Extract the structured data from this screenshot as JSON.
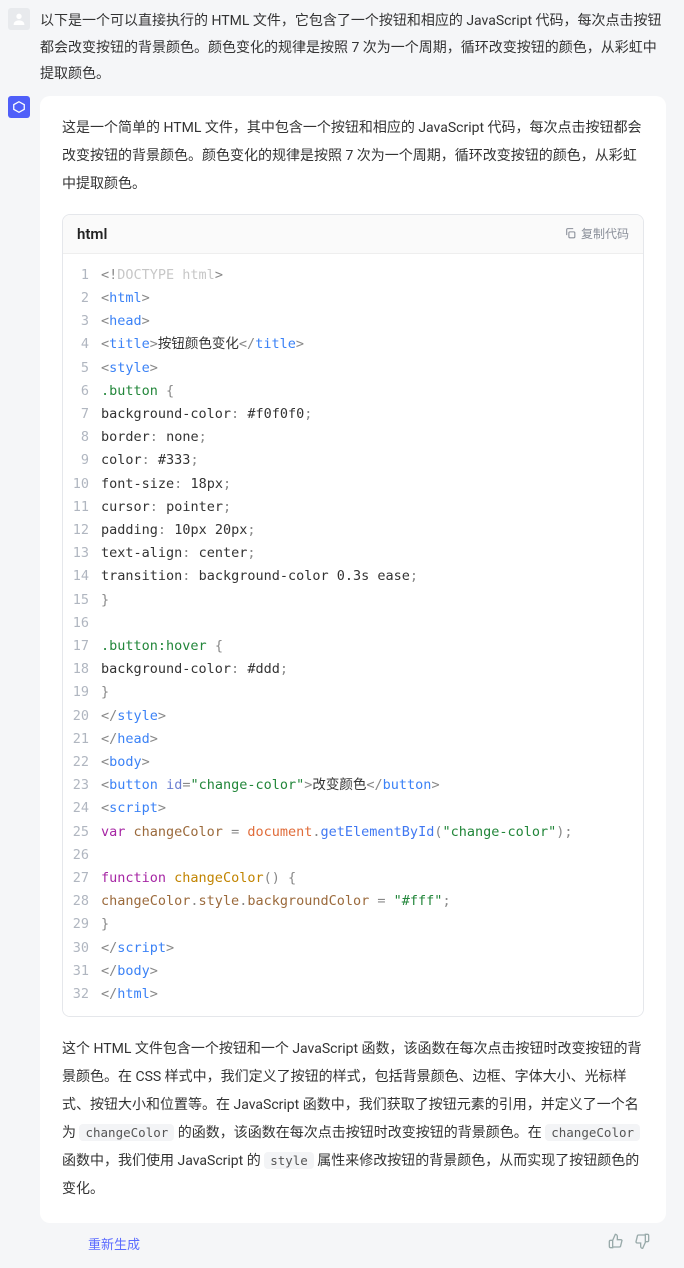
{
  "user_message": "以下是一个可以直接执行的 HTML 文件，它包含了一个按钮和相应的 JavaScript 代码，每次点击按钮都会改变按钮的背景颜色。颜色变化的规律是按照 7 次为一个周期，循环改变按钮的颜色，从彩虹中提取颜色。",
  "bot_intro": "这是一个简单的 HTML 文件，其中包含一个按钮和相应的 JavaScript 代码，每次点击按钮都会改变按钮的背景颜色。颜色变化的规律是按照 7 次为一个周期，循环改变按钮的颜色，从彩虹中提取颜色。",
  "code": {
    "language": "html",
    "copy_label": "复制代码",
    "lines": [
      {
        "n": "1",
        "html": "<span class='tok-punc'>&lt;!</span><span class='tok-doctype'>DOCTYPE html</span><span class='tok-punc'>&gt;</span>"
      },
      {
        "n": "2",
        "html": "<span class='tok-punc'>&lt;</span><span class='tok-tag'>html</span><span class='tok-punc'>&gt;</span>"
      },
      {
        "n": "3",
        "html": "<span class='tok-punc'>&lt;</span><span class='tok-tag'>head</span><span class='tok-punc'>&gt;</span>"
      },
      {
        "n": "4",
        "html": "<span class='tok-punc'>&lt;</span><span class='tok-tag'>title</span><span class='tok-punc'>&gt;</span><span class='tok-text'>按钮颜色变化</span><span class='tok-punc'>&lt;/</span><span class='tok-tag'>title</span><span class='tok-punc'>&gt;</span>"
      },
      {
        "n": "5",
        "html": "<span class='tok-punc'>&lt;</span><span class='tok-tag'>style</span><span class='tok-punc'>&gt;</span>"
      },
      {
        "n": "6",
        "html": "<span class='tok-selector'>.button</span> <span class='tok-punc'>{</span>"
      },
      {
        "n": "7",
        "html": "<span class='tok-prop'>background-color</span><span class='tok-punc'>:</span> <span class='tok-value'>#f0f0f0</span><span class='tok-punc'>;</span>"
      },
      {
        "n": "8",
        "html": "<span class='tok-prop'>border</span><span class='tok-punc'>:</span> <span class='tok-value'>none</span><span class='tok-punc'>;</span>"
      },
      {
        "n": "9",
        "html": "<span class='tok-prop'>color</span><span class='tok-punc'>:</span> <span class='tok-value'>#333</span><span class='tok-punc'>;</span>"
      },
      {
        "n": "10",
        "html": "<span class='tok-prop'>font-size</span><span class='tok-punc'>:</span> <span class='tok-value'>18px</span><span class='tok-punc'>;</span>"
      },
      {
        "n": "11",
        "html": "<span class='tok-prop'>cursor</span><span class='tok-punc'>:</span> <span class='tok-value'>pointer</span><span class='tok-punc'>;</span>"
      },
      {
        "n": "12",
        "html": "<span class='tok-prop'>padding</span><span class='tok-punc'>:</span> <span class='tok-value'>10px 20px</span><span class='tok-punc'>;</span>"
      },
      {
        "n": "13",
        "html": "<span class='tok-prop'>text-align</span><span class='tok-punc'>:</span> <span class='tok-value'>center</span><span class='tok-punc'>;</span>"
      },
      {
        "n": "14",
        "html": "<span class='tok-prop'>transition</span><span class='tok-punc'>:</span> <span class='tok-value'>background-color 0.3s ease</span><span class='tok-punc'>;</span>"
      },
      {
        "n": "15",
        "html": "<span class='tok-punc'>}</span>"
      },
      {
        "n": "16",
        "html": ""
      },
      {
        "n": "17",
        "html": "<span class='tok-selector'>.button:hover</span> <span class='tok-punc'>{</span>"
      },
      {
        "n": "18",
        "html": "<span class='tok-prop'>background-color</span><span class='tok-punc'>:</span> <span class='tok-value'>#ddd</span><span class='tok-punc'>;</span>"
      },
      {
        "n": "19",
        "html": "<span class='tok-punc'>}</span>"
      },
      {
        "n": "20",
        "html": "<span class='tok-punc'>&lt;/</span><span class='tok-tag'>style</span><span class='tok-punc'>&gt;</span>"
      },
      {
        "n": "21",
        "html": "<span class='tok-punc'>&lt;/</span><span class='tok-tag'>head</span><span class='tok-punc'>&gt;</span>"
      },
      {
        "n": "22",
        "html": "<span class='tok-punc'>&lt;</span><span class='tok-tag'>body</span><span class='tok-punc'>&gt;</span>"
      },
      {
        "n": "23",
        "html": "<span class='tok-punc'>&lt;</span><span class='tok-tag'>button</span> <span class='tok-attr'>id</span><span class='tok-punc'>=</span><span class='tok-string'>\"change-color\"</span><span class='tok-punc'>&gt;</span><span class='tok-text'>改变颜色</span><span class='tok-punc'>&lt;/</span><span class='tok-tag'>button</span><span class='tok-punc'>&gt;</span>"
      },
      {
        "n": "24",
        "html": "<span class='tok-punc'>&lt;</span><span class='tok-tag'>script</span><span class='tok-punc'>&gt;</span>"
      },
      {
        "n": "25",
        "html": "<span class='tok-kw'>var</span> <span class='tok-id'>changeColor</span> <span class='tok-punc'>=</span> <span class='tok-var'>document</span><span class='tok-punc'>.</span><span class='tok-func'>getElementById</span><span class='tok-punc'>(</span><span class='tok-string'>\"change-color\"</span><span class='tok-punc'>);</span>"
      },
      {
        "n": "26",
        "html": ""
      },
      {
        "n": "27",
        "html": "<span class='tok-kw'>function</span> <span class='tok-funcname'>changeColor</span><span class='tok-punc'>()</span> <span class='tok-punc'>{</span>"
      },
      {
        "n": "28",
        "html": "<span class='tok-id'>changeColor</span><span class='tok-punc'>.</span><span class='tok-id'>style</span><span class='tok-punc'>.</span><span class='tok-id'>backgroundColor</span> <span class='tok-punc'>=</span> <span class='tok-string'>\"#fff\"</span><span class='tok-punc'>;</span>"
      },
      {
        "n": "29",
        "html": "<span class='tok-punc'>}</span>"
      },
      {
        "n": "30",
        "html": "<span class='tok-punc'>&lt;/</span><span class='tok-tag'>script</span><span class='tok-punc'>&gt;</span>"
      },
      {
        "n": "31",
        "html": "<span class='tok-punc'>&lt;/</span><span class='tok-tag'>body</span><span class='tok-punc'>&gt;</span>"
      },
      {
        "n": "32",
        "html": "<span class='tok-punc'>&lt;/</span><span class='tok-tag'>html</span><span class='tok-punc'>&gt;</span>"
      }
    ]
  },
  "bot_outro_parts": [
    "这个 HTML 文件包含一个按钮和一个 JavaScript 函数，该函数在每次点击按钮时改变按钮的背景颜色。在 CSS 样式中，我们定义了按钮的样式，包括背景颜色、边框、字体大小、光标样式、按钮大小和位置等。在 JavaScript 函数中，我们获取了按钮元素的引用，并定义了一个名为 ",
    "changeColor",
    " 的函数，该函数在每次点击按钮时改变按钮的背景颜色。在 ",
    "changeColor",
    " 函数中，我们使用 JavaScript 的 ",
    "style",
    " 属性来修改按钮的背景颜色，从而实现了按钮颜色的变化。"
  ],
  "footer": {
    "regen": "重新生成"
  }
}
